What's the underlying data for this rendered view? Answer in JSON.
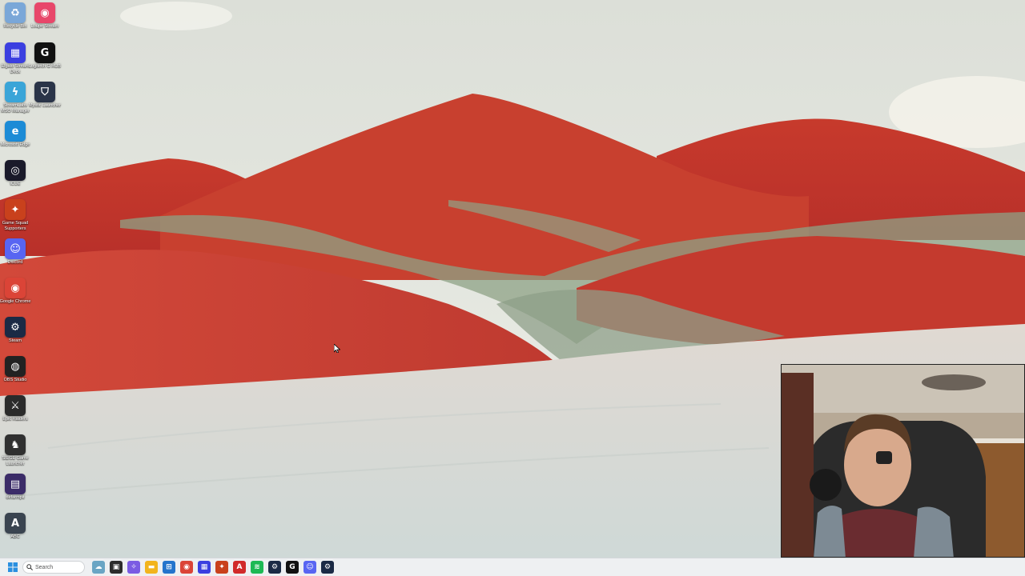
{
  "desktop": {
    "icons": [
      {
        "id": "recycle-bin",
        "label": "Recycle Bin",
        "icon": "recycle-bin-icon",
        "color": "#7aa7d8",
        "glyph": "♻"
      },
      {
        "id": "loupe",
        "label": "Loupe Stream",
        "icon": "map-pin-icon",
        "color": "#e8476a",
        "glyph": "◉"
      },
      {
        "id": "elgato",
        "label": "Elgato Stream Deck",
        "icon": "grid-icon",
        "color": "#3b3fe0",
        "glyph": "▦"
      },
      {
        "id": "logitech",
        "label": "Logitech G HUB",
        "icon": "logitech-g-icon",
        "color": "#111111",
        "glyph": "G"
      },
      {
        "id": "stream-manager",
        "label": "StreamLabs MSO Manager",
        "icon": "lightning-icon",
        "color": "#3aa5d8",
        "glyph": "ϟ"
      },
      {
        "id": "mystic",
        "label": "Mystic Launcher",
        "icon": "shield-icon",
        "color": "#2a3448",
        "glyph": "⛉"
      },
      {
        "id": "edge",
        "label": "Microsoft Edge",
        "icon": "edge-icon",
        "color": "#1c8bd6",
        "glyph": "e"
      },
      {
        "id": "icue",
        "label": "iCUE",
        "icon": "icue-icon",
        "color": "#1a1a2a",
        "glyph": "◎"
      },
      {
        "id": "game-squad",
        "label": "Game Squad Supporters",
        "icon": "game-squad-icon",
        "color": "#c9411c",
        "glyph": "✦"
      },
      {
        "id": "discord",
        "label": "Discord",
        "icon": "discord-icon",
        "color": "#5865f2",
        "glyph": "☺"
      },
      {
        "id": "chrome",
        "label": "Google Chrome",
        "icon": "chrome-icon",
        "color": "#db4437",
        "glyph": "◉"
      },
      {
        "id": "steam",
        "label": "Steam",
        "icon": "steam-icon",
        "color": "#1b2a45",
        "glyph": "⚙"
      },
      {
        "id": "obs",
        "label": "OBS Studio",
        "icon": "obs-icon",
        "color": "#222222",
        "glyph": "◍"
      },
      {
        "id": "epic-raiders",
        "label": "Epic Raiders",
        "icon": "game-icon",
        "color": "#2b2b2b",
        "glyph": "⚔"
      },
      {
        "id": "siege-game",
        "label": "SIEGE Game Launcher",
        "icon": "siege-icon",
        "color": "#303030",
        "glyph": "♞"
      },
      {
        "id": "defarmpit",
        "label": "defarmpit",
        "icon": "image-icon",
        "color": "#3b2c68",
        "glyph": "▤"
      },
      {
        "id": "font-app",
        "label": "ABC",
        "icon": "letter-a-icon",
        "color": "#3a4450",
        "glyph": "A"
      }
    ]
  },
  "taskbar": {
    "start_icon": "windows-start-icon",
    "search_placeholder": "Search",
    "pinned": [
      {
        "id": "widgets",
        "icon": "widgets-icon",
        "color": "#6aa5c4",
        "glyph": "☁"
      },
      {
        "id": "task-view",
        "icon": "task-view-icon",
        "color": "#2c2c2c",
        "glyph": "▣"
      },
      {
        "id": "copilot",
        "icon": "copilot-icon",
        "color": "#7b5be3",
        "glyph": "✧"
      },
      {
        "id": "file-explorer",
        "icon": "folder-icon",
        "color": "#f2b41d",
        "glyph": "▬"
      },
      {
        "id": "store",
        "icon": "store-icon",
        "color": "#2474cc",
        "glyph": "⊞"
      },
      {
        "id": "chrome",
        "icon": "chrome-icon",
        "color": "#db4437",
        "glyph": "◉"
      },
      {
        "id": "elgato",
        "icon": "grid-icon",
        "color": "#3b3fe0",
        "glyph": "▦"
      },
      {
        "id": "game-squad",
        "icon": "game-squad-icon",
        "color": "#c9411c",
        "glyph": "✦"
      },
      {
        "id": "adobe",
        "icon": "adobe-icon",
        "color": "#d12a2a",
        "glyph": "A"
      },
      {
        "id": "spotify",
        "icon": "spotify-icon",
        "color": "#1db954",
        "glyph": "≋"
      },
      {
        "id": "steam",
        "icon": "steam-icon",
        "color": "#1b2a45",
        "glyph": "⚙"
      },
      {
        "id": "logitech",
        "icon": "logitech-g-icon",
        "color": "#111111",
        "glyph": "G"
      },
      {
        "id": "discord",
        "icon": "discord-icon",
        "color": "#5865f2",
        "glyph": "☺"
      },
      {
        "id": "steam-2",
        "icon": "steam-icon",
        "color": "#1b2a45",
        "glyph": "⚙"
      }
    ]
  },
  "webcam": {
    "label": "webcam-overlay"
  },
  "colors": {
    "sky": "#e6e9e3",
    "dune_red": "#c4362c",
    "sand_pale": "#d9dcd6",
    "taskbar": "#eef0f2"
  }
}
